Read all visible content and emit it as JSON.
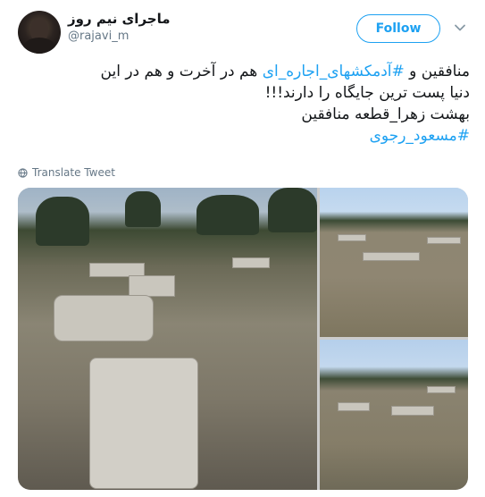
{
  "tweet": {
    "display_name": "ماجرای نیم روز",
    "handle": "@rajavi_m",
    "follow_label": "Follow",
    "text_line1_prefix": "منافقین و ",
    "hashtag1": "#آدمکشهای_اجاره_ای",
    "text_line1_suffix": " هم در آخرت و هم در این",
    "text_line2": "دنیا پست ترین جایگاه را دارند!!!",
    "text_line3": "بهشت زهرا_قطعه منافقین",
    "hashtag2": "#مسعود_رجوی",
    "translate_label": "Translate Tweet",
    "accent_color": "#1da1f2"
  },
  "icons": {
    "menu": "chevron-down-icon",
    "translate": "globe-icon"
  }
}
